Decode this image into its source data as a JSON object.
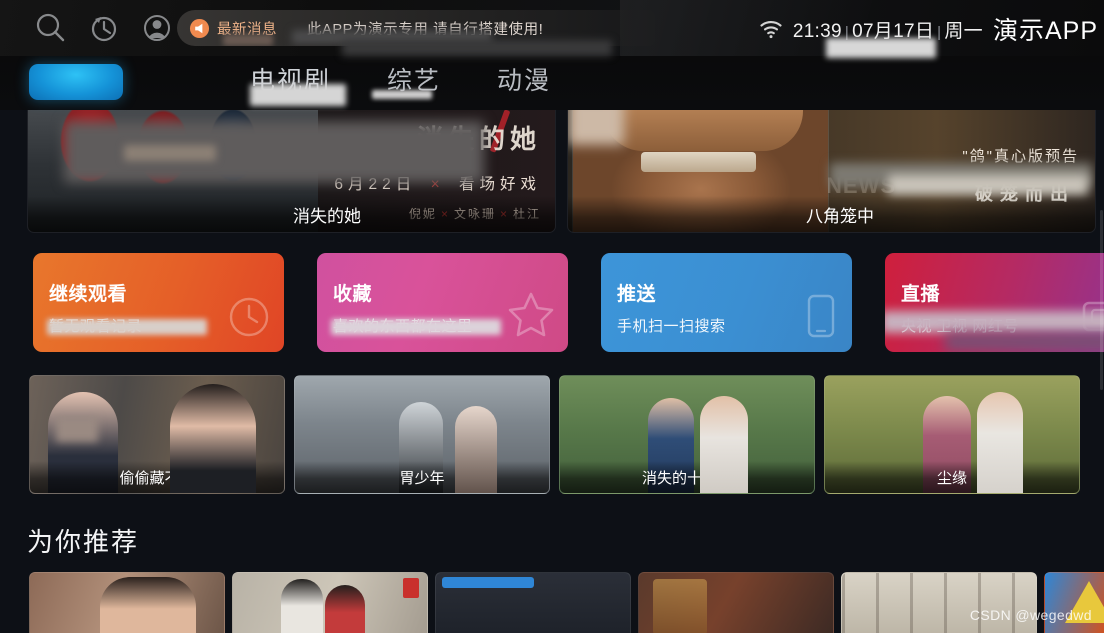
{
  "topbar": {
    "icons": [
      {
        "name": "search-icon",
        "label": "搜索"
      },
      {
        "name": "history-icon",
        "label": "历史记录"
      },
      {
        "name": "user-icon",
        "label": "用户"
      }
    ],
    "news": {
      "icon": "megaphone-icon",
      "label": "最新消息",
      "marquee": "此APP为演示专用  请自行搭建使用!"
    },
    "wifi_icon": "wifi-icon",
    "time": "21:39",
    "date": "07月17日",
    "weekday": "周一",
    "separator": "|",
    "app_name": "演示APP"
  },
  "nav": {
    "selected_pill_color": "#1f9ad8",
    "tabs": [
      {
        "label": "",
        "selected": true
      },
      {
        "label": "电视剧",
        "selected": false
      },
      {
        "label": "综艺",
        "selected": false
      },
      {
        "label": "动漫",
        "selected": false
      }
    ]
  },
  "heroes": [
    {
      "title": "消失的她",
      "logo": "消失的她",
      "date_line": "6月22日",
      "tagline": "看场好戏",
      "cast": [
        "倪妮",
        "文咏珊",
        "杜江"
      ]
    },
    {
      "title": "八角笼中",
      "subline": "\"鸽\"真心版预告",
      "tagline": "破笼而出",
      "overlay_text": "NEWS"
    }
  ],
  "quick_cards": [
    {
      "title": "继续观看",
      "subtitle": "暂无观看记录",
      "icon": "clock-icon",
      "color": "#e8772c"
    },
    {
      "title": "收藏",
      "subtitle": "喜欢的东西都在这里",
      "icon": "star-icon",
      "color": "#d0519f"
    },
    {
      "title": "推送",
      "subtitle": "手机扫一扫搜索",
      "icon": "phone-icon",
      "color": "#3d95d9"
    },
    {
      "title": "直播",
      "subtitle": "央视 卫视 网红号",
      "icon": "tv-icon",
      "color": "#cf1f3c"
    }
  ],
  "thumbnails": [
    {
      "title": "偷偷藏不住"
    },
    {
      "title": "胃少年"
    },
    {
      "title": "消失的十一层"
    },
    {
      "title": "尘缘"
    }
  ],
  "section": {
    "title": "为你推荐"
  },
  "posters": [
    {
      "title": ""
    },
    {
      "title": ""
    },
    {
      "title": ""
    },
    {
      "title": ""
    },
    {
      "title": ""
    },
    {
      "title": ""
    },
    {
      "title": ""
    }
  ],
  "watermark": "CSDN @wegedwd"
}
